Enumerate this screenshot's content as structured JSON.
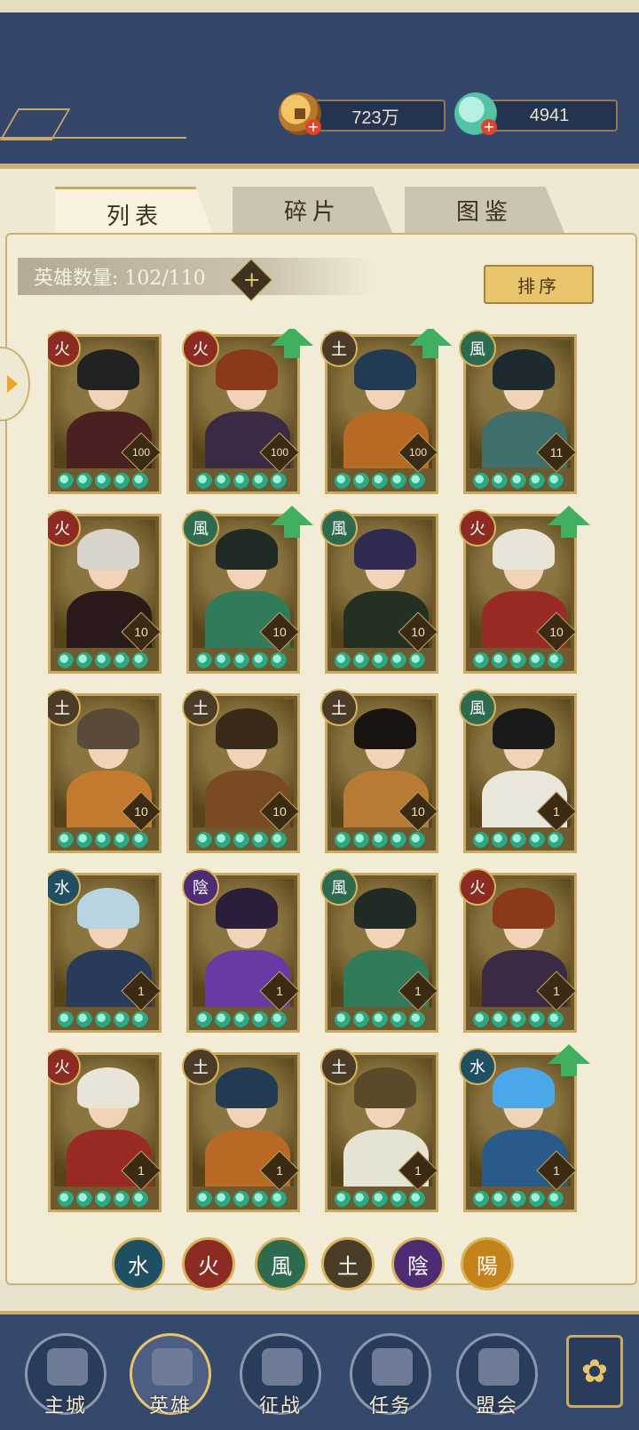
{
  "resources": {
    "coins": "723万",
    "jade": "4941"
  },
  "tabs": [
    {
      "label": "列表",
      "active": true
    },
    {
      "label": "碎片",
      "active": false
    },
    {
      "label": "图鉴",
      "active": false
    }
  ],
  "hero_count": {
    "label": "英雄数量: 102/110",
    "plus": "+"
  },
  "sort_label": "排序",
  "element_glyphs": {
    "fire": "火",
    "earth": "土",
    "wind": "風",
    "water": "水",
    "yin": "陰",
    "yang": "陽"
  },
  "heroes": [
    {
      "element": "fire",
      "level": "100",
      "upgrade": false,
      "hair": "#222222",
      "body": "#4a2020"
    },
    {
      "element": "fire",
      "level": "100",
      "upgrade": true,
      "hair": "#8a3a1a",
      "body": "#3a2a44"
    },
    {
      "element": "earth",
      "level": "100",
      "upgrade": true,
      "hair": "#223a52",
      "body": "#b86a24"
    },
    {
      "element": "wind",
      "level": "11",
      "upgrade": false,
      "hair": "#1d2a30",
      "body": "#3e6f6a"
    },
    {
      "element": "fire",
      "level": "10",
      "upgrade": false,
      "hair": "#d8d4cc",
      "body": "#2a1a1a"
    },
    {
      "element": "wind",
      "level": "10",
      "upgrade": true,
      "hair": "#1f2b24",
      "body": "#2f7b5a"
    },
    {
      "element": "wind",
      "level": "10",
      "upgrade": false,
      "hair": "#2f2a52",
      "body": "#243022"
    },
    {
      "element": "fire",
      "level": "10",
      "upgrade": true,
      "hair": "#e9e4d8",
      "body": "#9a2a24"
    },
    {
      "element": "earth",
      "level": "10",
      "upgrade": false,
      "hair": "#5a4a3a",
      "body": "#c47a2e"
    },
    {
      "element": "earth",
      "level": "10",
      "upgrade": false,
      "hair": "#3a2a1a",
      "body": "#7a4a22"
    },
    {
      "element": "earth",
      "level": "10",
      "upgrade": false,
      "hair": "#1a1410",
      "body": "#b87a34"
    },
    {
      "element": "wind",
      "level": "1",
      "upgrade": false,
      "hair": "#1a1a1a",
      "body": "#e9e6dc"
    },
    {
      "element": "water",
      "level": "1",
      "upgrade": false,
      "hair": "#b8d4e0",
      "body": "#2a3a5a"
    },
    {
      "element": "yin",
      "level": "1",
      "upgrade": false,
      "hair": "#2a1e3a",
      "body": "#6a3aa4"
    },
    {
      "element": "wind",
      "level": "1",
      "upgrade": false,
      "hair": "#1f2b24",
      "body": "#2f7b5a"
    },
    {
      "element": "fire",
      "level": "1",
      "upgrade": false,
      "hair": "#8a3a1a",
      "body": "#3a2a44"
    },
    {
      "element": "fire",
      "level": "1",
      "upgrade": false,
      "hair": "#e9e4d8",
      "body": "#9a2a24"
    },
    {
      "element": "earth",
      "level": "1",
      "upgrade": false,
      "hair": "#223a52",
      "body": "#b86a24"
    },
    {
      "element": "earth",
      "level": "1",
      "upgrade": false,
      "hair": "#5a4a2a",
      "body": "#e6e2d4"
    },
    {
      "element": "water",
      "level": "1",
      "upgrade": true,
      "hair": "#4aa8e8",
      "body": "#2a5a8a"
    }
  ],
  "element_filters": [
    {
      "element": "water",
      "glyph": "水"
    },
    {
      "element": "fire",
      "glyph": "火"
    },
    {
      "element": "wind",
      "glyph": "風"
    },
    {
      "element": "earth",
      "glyph": "土"
    },
    {
      "element": "yin",
      "glyph": "陰"
    },
    {
      "element": "yang",
      "glyph": "陽"
    }
  ],
  "nav": [
    {
      "label": "主城",
      "icon": "city-gate-icon",
      "active": false
    },
    {
      "label": "英雄",
      "icon": "hero-portrait-icon",
      "active": true
    },
    {
      "label": "征战",
      "icon": "war-horn-icon",
      "active": false
    },
    {
      "label": "任务",
      "icon": "scroll-bell-icon",
      "active": false
    },
    {
      "label": "盟会",
      "icon": "pavilion-icon",
      "active": false
    }
  ],
  "colors": {
    "header_bg": "#34476a",
    "accent_gold": "#c9a964",
    "panel_bg": "#f2ecd7",
    "upgrade_green": "#40b060"
  }
}
